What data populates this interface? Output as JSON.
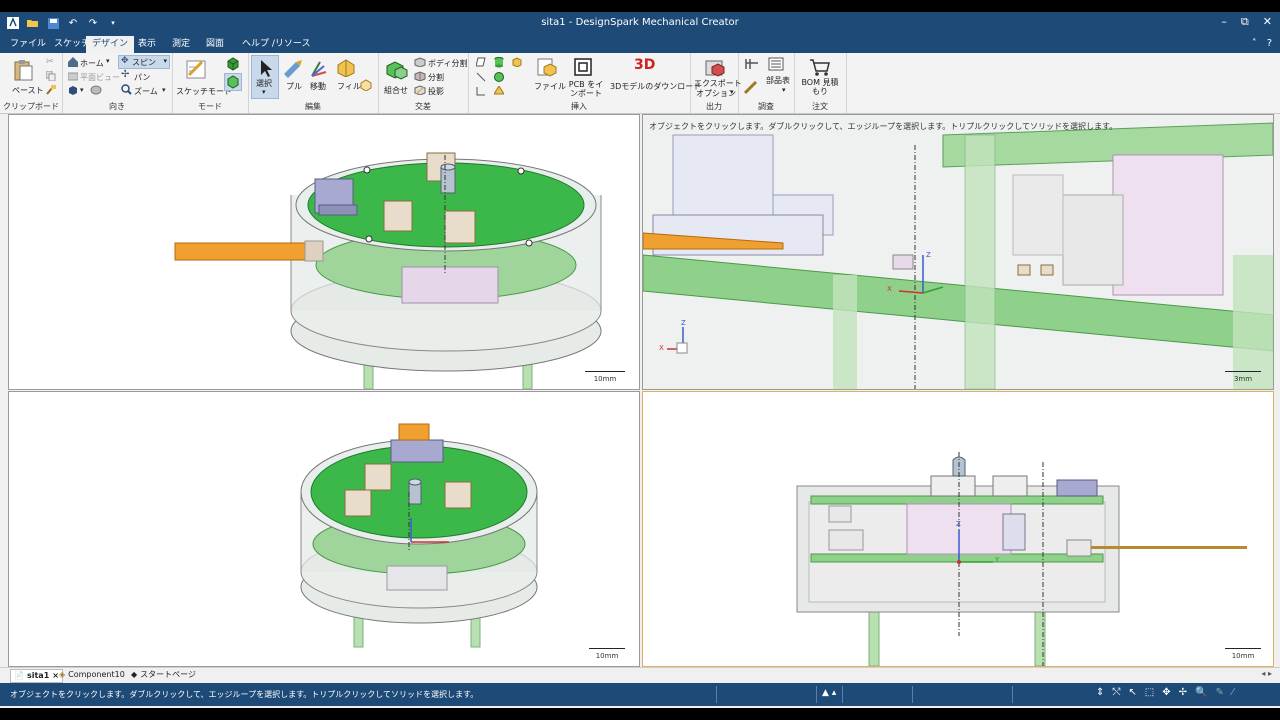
{
  "window": {
    "title": "sita1 - DesignSpark Mechanical Creator",
    "minimize": "–",
    "restore": "⧉",
    "close": "✕"
  },
  "menu": {
    "tabs": [
      "ファイル",
      "スケッチ",
      "デザイン",
      "表示",
      "測定",
      "図面",
      "ヘルプ /リソース"
    ],
    "active": "デザイン",
    "collapse": "˄",
    "help": "?"
  },
  "ribbon": {
    "clipboard": {
      "paste": "ペースト",
      "group": "クリップボード"
    },
    "orient": {
      "home": "ホーム",
      "plan_view": "平面ビュー",
      "spin": "スピン",
      "pan": "パン",
      "zoom": "ズーム",
      "group": "向き"
    },
    "mode": {
      "sketch_mode": "スケッチモード",
      "group": "モード"
    },
    "edit": {
      "select": "選択",
      "pull": "プル",
      "move": "移動",
      "fill": "フィル",
      "group": "編集"
    },
    "intersect": {
      "combine": "組合せ",
      "split_body": "ボディ分割",
      "split": "分割",
      "project": "投影",
      "group": "交差"
    },
    "insert": {
      "file": "ファイル",
      "pcb_import": "PCB をインポート",
      "model_download": "3Dモデルのダウンロード",
      "badge_3d": "3D",
      "group": "挿入"
    },
    "output": {
      "export": "エクスポート",
      "options": "オプション",
      "group": "出力"
    },
    "investigate": {
      "parts_table": "部品表",
      "group": "調査"
    },
    "order": {
      "bom_quote": "BOM 見積もり",
      "group": "注文"
    }
  },
  "viewports": {
    "top_left": {
      "scale": "10mm"
    },
    "top_right": {
      "scale": "3mm",
      "hint": "オブジェクトをクリックします。ダブルクリックして、エッジループを選択します。トリプルクリックしてソリッドを選択します。",
      "axis_x": "X",
      "axis_z": "Z"
    },
    "bottom_left": {
      "scale": "10mm"
    },
    "bottom_right": {
      "scale": "10mm",
      "axis_y": "Y",
      "axis_z": "Z"
    }
  },
  "doc_tabs": [
    {
      "label": "sita1",
      "close": "×"
    },
    {
      "label": "Component10"
    },
    {
      "label": "スタートページ"
    }
  ],
  "doc_tabs_nav": "◂ ▸",
  "status": {
    "message": "オブジェクトをクリックします。ダブルクリックして、エッジループを選択します。トリプルクリックしてソリッドを選択します。"
  },
  "colors": {
    "titlebar": "#1e4a78",
    "pcb": "#3ab84a",
    "enclosure": "#cfd8d4",
    "connector": "#f0a030"
  }
}
